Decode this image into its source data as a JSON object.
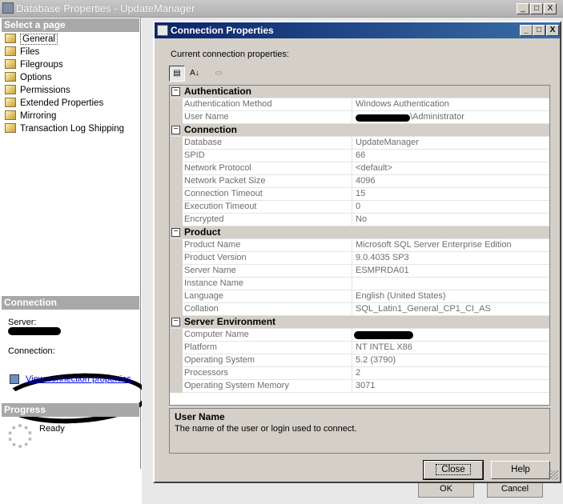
{
  "outer_window": {
    "title": "Database Properties - UpdateManager",
    "controls": {
      "minimize": "_",
      "maximize": "□",
      "close": "X"
    }
  },
  "left_pane": {
    "select_page_header": "Select a page",
    "pages": [
      {
        "label": "General",
        "icon": "page-icon",
        "selected": true
      },
      {
        "label": "Files",
        "icon": "page-icon",
        "selected": false
      },
      {
        "label": "Filegroups",
        "icon": "page-icon",
        "selected": false
      },
      {
        "label": "Options",
        "icon": "page-icon",
        "selected": false
      },
      {
        "label": "Permissions",
        "icon": "page-icon",
        "selected": false
      },
      {
        "label": "Extended Properties",
        "icon": "page-icon",
        "selected": false
      },
      {
        "label": "Mirroring",
        "icon": "page-icon",
        "selected": false
      },
      {
        "label": "Transaction Log Shipping",
        "icon": "page-icon",
        "selected": false
      }
    ],
    "connection_header": "Connection",
    "server_label": "Server:",
    "connection_label": "Connection:",
    "view_connection_link": "View connection properties",
    "progress_header": "Progress",
    "progress_status": "Ready"
  },
  "background_buttons": {
    "ok": "OK",
    "cancel": "Cancel"
  },
  "dialog": {
    "title": "Connection Properties",
    "controls": {
      "minimize": "_",
      "maximize": "□",
      "close": "X"
    },
    "current_label": "Current connection properties:",
    "toolbar": {
      "categorized": "▤",
      "alphabetical": "A↓",
      "property_pages": "▭"
    },
    "categories": [
      {
        "name": "Authentication",
        "rows": [
          {
            "name": "Authentication Method",
            "value": "Windows Authentication"
          },
          {
            "name": "User Name",
            "value": "\\Administrator",
            "redacted_prefix": true
          }
        ]
      },
      {
        "name": "Connection",
        "rows": [
          {
            "name": "Database",
            "value": "UpdateManager"
          },
          {
            "name": "SPID",
            "value": "66"
          },
          {
            "name": "Network Protocol",
            "value": "<default>"
          },
          {
            "name": "Network Packet Size",
            "value": "4096"
          },
          {
            "name": "Connection Timeout",
            "value": "15"
          },
          {
            "name": "Execution Timeout",
            "value": "0"
          },
          {
            "name": "Encrypted",
            "value": "No"
          }
        ]
      },
      {
        "name": "Product",
        "rows": [
          {
            "name": "Product Name",
            "value": "Microsoft SQL Server Enterprise Edition"
          },
          {
            "name": "Product Version",
            "value": "9.0.4035 SP3"
          },
          {
            "name": "Server Name",
            "value": "ESMPRDA01"
          },
          {
            "name": "Instance Name",
            "value": ""
          },
          {
            "name": "Language",
            "value": "English (United States)"
          },
          {
            "name": "Collation",
            "value": "SQL_Latin1_General_CP1_CI_AS"
          }
        ]
      },
      {
        "name": "Server Environment",
        "rows": [
          {
            "name": "Computer Name",
            "value": "",
            "redacted": true
          },
          {
            "name": "Platform",
            "value": "NT INTEL X86"
          },
          {
            "name": "Operating System",
            "value": "5.2 (3790)"
          },
          {
            "name": "Processors",
            "value": "2"
          },
          {
            "name": "Operating System Memory",
            "value": "3071"
          }
        ]
      }
    ],
    "description": {
      "title": "User Name",
      "text": "The name of the user or login used to connect."
    },
    "close_button": "Close",
    "help_button": "Help"
  }
}
